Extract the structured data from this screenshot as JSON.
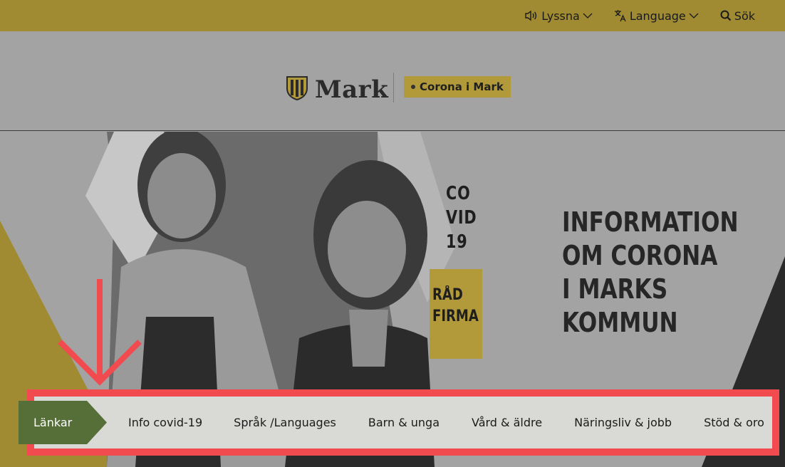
{
  "topbar": {
    "listen": {
      "label": "Lyssna",
      "icon": "speaker-icon"
    },
    "language": {
      "label": "Language",
      "icon": "translate-icon"
    },
    "search": {
      "label": "Sök",
      "icon": "search-icon"
    }
  },
  "header": {
    "logo_text": "Mark",
    "badge_label": "Corona i Mark"
  },
  "hero": {
    "covid_lines": [
      "CO",
      "VID",
      "19"
    ],
    "raad_lines": [
      "RÅD",
      "FIRMA"
    ],
    "headline_lines": [
      "INFORMATION",
      "OM CORONA",
      "I MARKS",
      "KOMMUN"
    ]
  },
  "nav": {
    "items": [
      {
        "label": "Länkar",
        "active": true
      },
      {
        "label": "Info covid-19"
      },
      {
        "label": "Språk /Languages"
      },
      {
        "label": "Barn & unga"
      },
      {
        "label": "Vård & äldre"
      },
      {
        "label": "Näringsliv & jobb"
      },
      {
        "label": "Stöd & oro"
      }
    ]
  },
  "colors": {
    "topbar": "#a08b33",
    "accent_gold": "#b29a3b",
    "nav_active": "#566e38",
    "annotation_red": "#f14a4f"
  }
}
